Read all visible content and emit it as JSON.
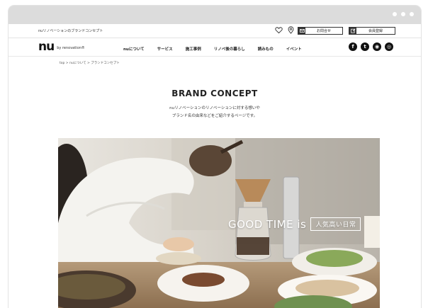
{
  "utility": {
    "tagline": "nuリノベーションのブランドコンセプト",
    "sample_label": "お問合せ",
    "member_label": "会員登録",
    "icons": [
      "heart-icon",
      "location-pin-icon"
    ]
  },
  "nav": {
    "logo_mark": "nu",
    "logo_sub": "by renovation®",
    "links": [
      "nuについて",
      "サービス",
      "施工事例",
      "リノベ後の暮らし",
      "読みもの",
      "イベント"
    ],
    "social": [
      "f",
      "t",
      "◉",
      "◎"
    ]
  },
  "breadcrumb": "top > nuについて > ブランドコンセプト",
  "page": {
    "title": "BRAND CONCEPT",
    "desc_line1": "nuリノベーションのリノベーションに対する想いや",
    "desc_line2": "ブランド名の由来などをご紹介するページです。"
  },
  "hero": {
    "copy": "GOOD TIME is",
    "tag": "人気高い日常"
  },
  "colors": {
    "text": "#222222",
    "accent": "#111111",
    "chrome": "#dcdcdc"
  }
}
